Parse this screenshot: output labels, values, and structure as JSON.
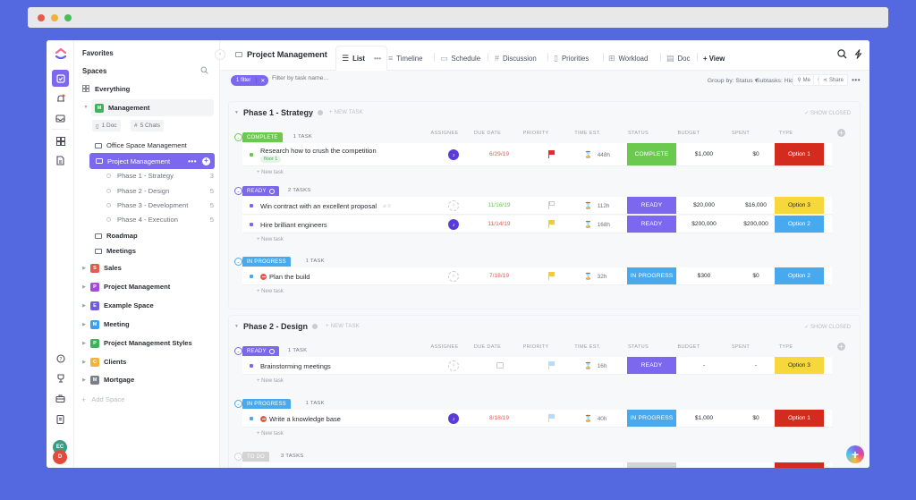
{
  "browser": {
    "dots": [
      "close",
      "minimize",
      "maximize"
    ]
  },
  "rail": {
    "icons": [
      "logo-icon",
      "tasks-icon",
      "notifications-icon",
      "inbox-icon",
      "dashboards-icon",
      "docs-icon",
      "help-icon",
      "goals-icon",
      "portfolio-icon",
      "clipboard-icon"
    ],
    "avatars": [
      "EC",
      "D"
    ]
  },
  "sidebar": {
    "favorites": "Favorites",
    "spaces": "Spaces",
    "everything": "Everything",
    "management": {
      "badge": "M",
      "label": "Management",
      "color": "#3fb35c"
    },
    "chips": {
      "doc": "1 Doc",
      "chats": "5 Chats"
    },
    "folders": [
      {
        "label": "Office Space Management"
      },
      {
        "label": "Project Management"
      }
    ],
    "phases": [
      {
        "label": "Phase 1 - Strategy",
        "count": "3"
      },
      {
        "label": "Phase 2 - Design",
        "count": "5"
      },
      {
        "label": "Phase 3 - Development",
        "count": "5"
      },
      {
        "label": "Phase 4 - Execution",
        "count": "5"
      }
    ],
    "lists": [
      {
        "label": "Roadmap"
      },
      {
        "label": "Meetings"
      }
    ],
    "spaces_list": [
      {
        "badge": "S",
        "label": "Sales",
        "color": "#e05c4c"
      },
      {
        "badge": "P",
        "label": "Project Management",
        "color": "#a44bd6"
      },
      {
        "badge": "E",
        "label": "Example Space",
        "color": "#6f5ce3"
      },
      {
        "badge": "M",
        "label": "Meeting",
        "color": "#3aa0f2"
      },
      {
        "badge": "P",
        "label": "Project Management Styles",
        "color": "#3fb35c"
      },
      {
        "badge": "C",
        "label": "Clients",
        "color": "#f0b43a"
      },
      {
        "badge": "M",
        "label": "Mortgage",
        "color": "#7b7f88"
      }
    ],
    "add_space": "Add Space"
  },
  "header": {
    "breadcrumb": "Project Management",
    "tabs": [
      {
        "label": "List",
        "icon": "list-icon",
        "active": true
      },
      {
        "label": "Timeline",
        "icon": "timeline-icon"
      },
      {
        "label": "Schedule",
        "icon": "calendar-icon"
      },
      {
        "label": "Discussion",
        "icon": "hash-icon"
      },
      {
        "label": "Priorities",
        "icon": "priorities-icon"
      },
      {
        "label": "Workload",
        "icon": "workload-icon"
      },
      {
        "label": "Doc",
        "icon": "doc-icon"
      }
    ],
    "add_view": "+ View",
    "more": "•••"
  },
  "filterbar": {
    "filter_pill": "1 filter",
    "filter_placeholder": "Filter by task name...",
    "group_by": "Group by: Status ▾",
    "subtasks": "Subtasks: Hide ▾",
    "me": "Me",
    "share": "Share"
  },
  "columns": [
    "ASSIGNEE",
    "DUE DATE",
    "PRIORITY",
    "TIME EST.",
    "STATUS",
    "BUDGET",
    "SPENT",
    "TYPE"
  ],
  "show_closed": "✓ SHOW CLOSED",
  "new_task_header": "+ NEW TASK",
  "new_task_row": "+ New task",
  "phases": [
    {
      "title": "Phase 1 - Strategy",
      "groups": [
        {
          "status": "COMPLETE",
          "count": "1 TASK",
          "color": "#6bc950",
          "tasks": [
            {
              "name": "Research how to crush the competition",
              "tag": "floor 1",
              "assignee": "J",
              "due": "6/29/19",
              "due_color": "#e05c4c",
              "priority": "urgent",
              "time": "448h",
              "status": "COMPLETE",
              "budget": "$1,000",
              "spent": "$0",
              "type": "Option 1"
            }
          ]
        },
        {
          "status": "READY",
          "count": "2 TASKS",
          "color": "#7b68ee",
          "tasks": [
            {
              "name": "Win contract with an excellent proposal",
              "assignee": "",
              "due": "11/16/19",
              "due_color": "#6bc950",
              "priority": "none",
              "time": "112h",
              "status": "READY",
              "budget": "$20,000",
              "spent": "$16,000",
              "type": "Option 3"
            },
            {
              "name": "Hire brilliant engineers",
              "assignee": "J",
              "due": "11/14/19",
              "due_color": "#e05c4c",
              "priority": "high",
              "time": "168h",
              "status": "READY",
              "budget": "$200,000",
              "spent": "$200,000",
              "type": "Option 2"
            }
          ]
        },
        {
          "status": "IN PROGRESS",
          "count": "1 TASK",
          "color": "#49a9ee",
          "tasks": [
            {
              "name": "Plan the build",
              "blocked": true,
              "assignee": "",
              "due": "7/18/19",
              "due_color": "#e05c4c",
              "priority": "high",
              "time": "32h",
              "status": "IN PROGRESS",
              "budget": "$300",
              "spent": "$0",
              "type": "Option 2"
            }
          ]
        }
      ]
    },
    {
      "title": "Phase 2 - Design",
      "groups": [
        {
          "status": "READY",
          "count": "1 TASK",
          "color": "#7b68ee",
          "tasks": [
            {
              "name": "Brainstorming meetings",
              "assignee": "",
              "due": "",
              "priority": "low",
              "time": "16h",
              "status": "READY",
              "budget": "-",
              "spent": "-",
              "type": "Option 3"
            }
          ]
        },
        {
          "status": "IN PROGRESS",
          "count": "1 TASK",
          "color": "#49a9ee",
          "tasks": [
            {
              "name": "Write a knowledge base",
              "blocked": true,
              "assignee": "J",
              "due": "8/18/19",
              "due_color": "#e05c4c",
              "priority": "low",
              "time": "40h",
              "status": "IN PROGRESS",
              "budget": "$1,000",
              "spent": "$0",
              "type": "Option 1"
            }
          ]
        },
        {
          "status": "TO DO",
          "count": "3 TASKS",
          "color": "#d3d3d3",
          "tasks": []
        }
      ]
    }
  ],
  "colors": {
    "accent": "#7b68ee",
    "complete": "#6bc950",
    "ready": "#7b68ee",
    "in_progress": "#49a9ee",
    "todo": "#d3d3d3",
    "option1": "#d42b1f",
    "option2": "#49a9ee",
    "option3": "#f6d83c",
    "background": "#5468e0"
  }
}
